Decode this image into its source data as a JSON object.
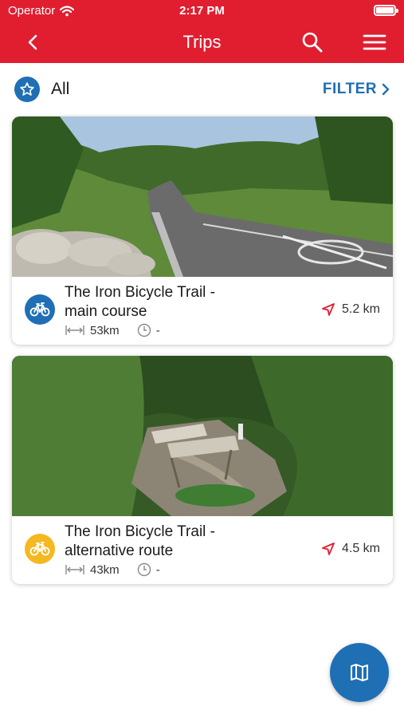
{
  "status_bar": {
    "carrier": "Operator",
    "time": "2:17 PM"
  },
  "nav": {
    "title": "Trips"
  },
  "filter_bar": {
    "all_label": "All",
    "filter_label": "FILTER"
  },
  "trips": [
    {
      "name_line1": "The Iron Bicycle Trail -",
      "name_line2": "main course",
      "length": "53km",
      "duration": "-",
      "distance": "5.2 km",
      "icon_color": "#1f6fb5",
      "icon": "bicycle-icon"
    },
    {
      "name_line1": "The Iron Bicycle Trail -",
      "name_line2": "alternative route",
      "length": "43km",
      "duration": "-",
      "distance": "4.5 km",
      "icon_color": "#f5b820",
      "icon": "bicycle-icon"
    }
  ],
  "colors": {
    "brand_red": "#e01e30",
    "accent_blue": "#1f6fb5",
    "accent_yellow": "#f5b820"
  }
}
